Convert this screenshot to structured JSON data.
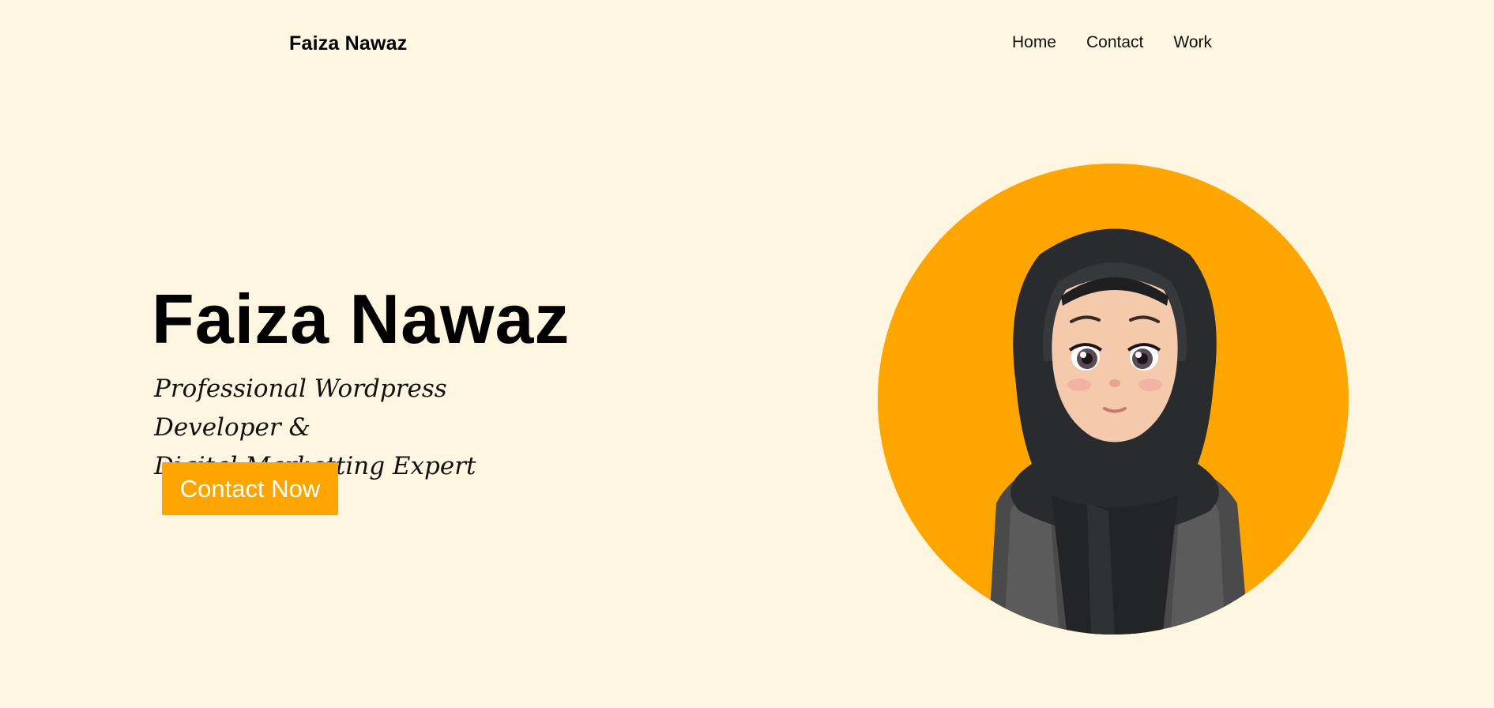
{
  "header": {
    "brand": "Faiza Nawaz",
    "nav": [
      "Home",
      "Contact",
      "Work"
    ]
  },
  "hero": {
    "title": "Faiza Nawaz",
    "subtitle_line1": "Professional Wordpress Developer &",
    "subtitle_line2": "Digital Marketting Expert",
    "cta_label": "Contact Now"
  },
  "avatar": {
    "icon": "avatar-illustration",
    "circle_color": "#ffa500"
  },
  "colors": {
    "background": "#fff6e1",
    "accent": "#ffa500",
    "text": "#000000",
    "button_text": "#ffffff"
  }
}
